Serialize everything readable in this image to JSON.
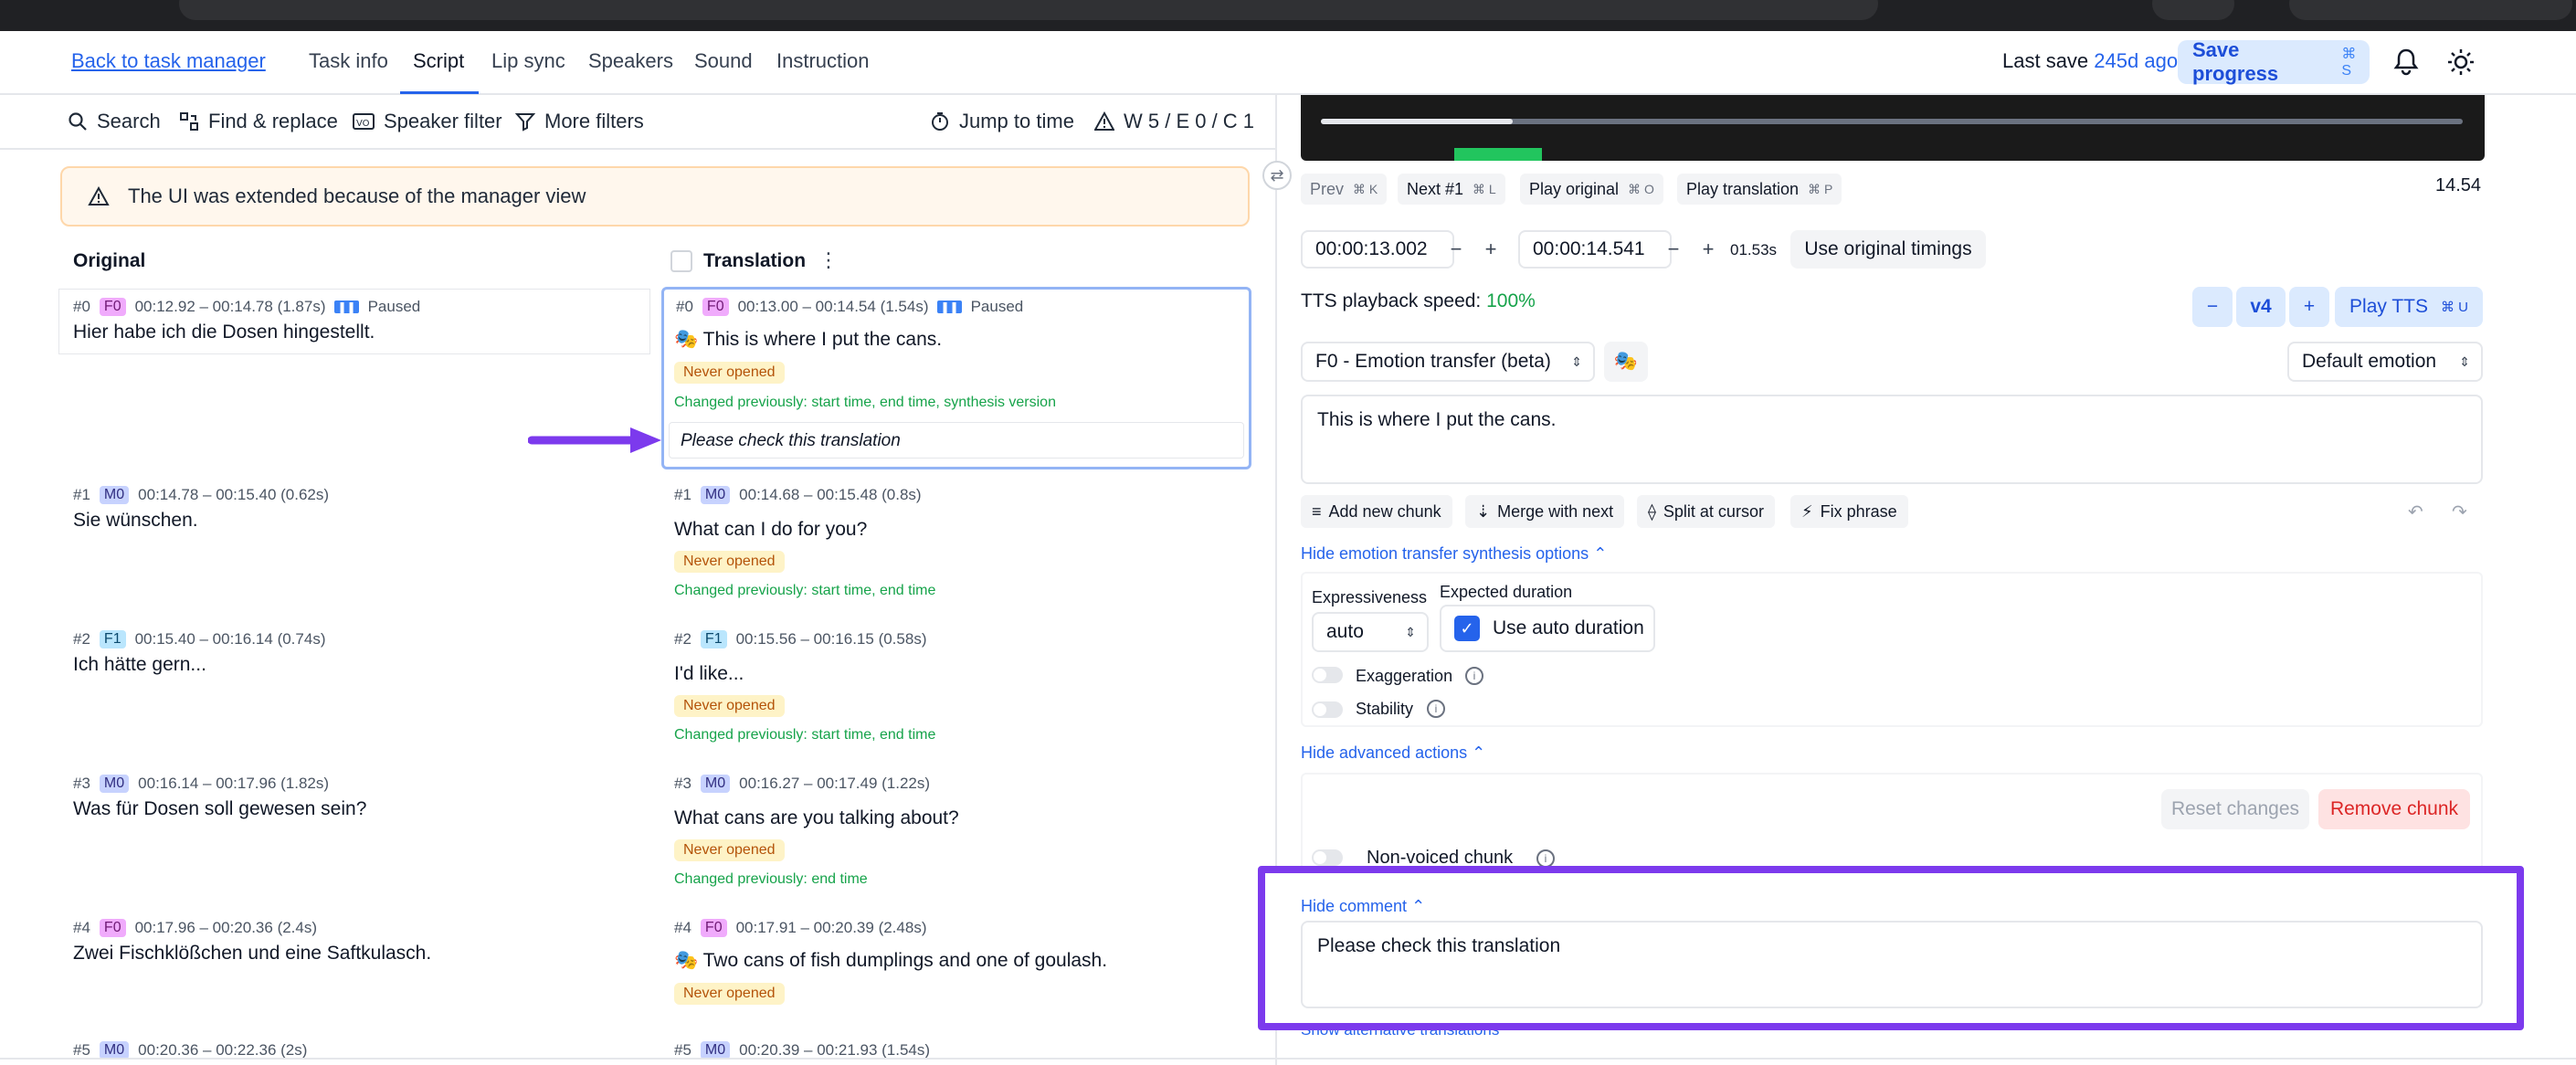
{
  "header": {
    "back_link": "Back to task manager",
    "tabs": [
      {
        "label": "Task info"
      },
      {
        "label": "Script"
      },
      {
        "label": "Lip sync"
      },
      {
        "label": "Speakers"
      },
      {
        "label": "Sound"
      },
      {
        "label": "Instruction"
      }
    ],
    "last_save_label": "Last save",
    "last_save_ago": "245d ago",
    "save_label": "Save progress",
    "save_shortcut": "⌘ S"
  },
  "toolbar": {
    "search": "Search",
    "find_replace": "Find & replace",
    "speaker_filter": "Speaker filter",
    "more_filters": "More filters",
    "jump_to_time": "Jump to time",
    "counts": "W 5 / E 0 / C 1"
  },
  "banner": {
    "text": "The UI was extended because of the manager view"
  },
  "columns": {
    "original": "Original",
    "translation": "Translation"
  },
  "chunks": [
    {
      "orig": {
        "id": "#0",
        "speaker": "F0",
        "time": "00:12.92 – 00:14.78 (1.87s)",
        "paused": "Paused",
        "text": "Hier habe ich die Dosen hingestellt."
      },
      "tr": {
        "id": "#0",
        "speaker": "F0",
        "time": "00:13.00 – 00:14.54 (1.54s)",
        "paused": "Paused",
        "text": "This is where I put the cans.",
        "status": "Never opened",
        "changed": "Changed previously: start time, end time, synthesis version",
        "comment": "Please check this translation"
      }
    },
    {
      "orig": {
        "id": "#1",
        "speaker": "M0",
        "time": "00:14.78 – 00:15.40 (0.62s)",
        "text": "Sie wünschen."
      },
      "tr": {
        "id": "#1",
        "speaker": "M0",
        "time": "00:14.68 – 00:15.48 (0.8s)",
        "text": "What can I do for you?",
        "status": "Never opened",
        "changed": "Changed previously: start time, end time"
      }
    },
    {
      "orig": {
        "id": "#2",
        "speaker": "F1",
        "time": "00:15.40 – 00:16.14 (0.74s)",
        "text": "Ich hätte gern..."
      },
      "tr": {
        "id": "#2",
        "speaker": "F1",
        "time": "00:15.56 – 00:16.15 (0.58s)",
        "text": "I'd like...",
        "status": "Never opened",
        "changed": "Changed previously: start time, end time"
      }
    },
    {
      "orig": {
        "id": "#3",
        "speaker": "M0",
        "time": "00:16.14 – 00:17.96 (1.82s)",
        "text": "Was für Dosen soll gewesen sein?"
      },
      "tr": {
        "id": "#3",
        "speaker": "M0",
        "time": "00:16.27 – 00:17.49 (1.22s)",
        "text": "What cans are you talking about?",
        "status": "Never opened",
        "changed": "Changed previously: end time"
      }
    },
    {
      "orig": {
        "id": "#4",
        "speaker": "F0",
        "time": "00:17.96 – 00:20.36 (2.4s)",
        "text": "Zwei Fischklößchen und eine Saftkulasch."
      },
      "tr": {
        "id": "#4",
        "speaker": "F0",
        "time": "00:17.91 – 00:20.39 (2.48s)",
        "text": "Two cans of fish dumplings and one of goulash.",
        "status": "Never opened"
      }
    },
    {
      "orig": {
        "id": "#5",
        "speaker": "M0",
        "time": "00:20.36 – 00:22.36 (2s)"
      },
      "tr": {
        "id": "#5",
        "speaker": "M0",
        "time": "00:20.39 – 00:21.93 (1.54s)"
      }
    }
  ],
  "player": {
    "prev": "Prev",
    "prev_key": "⌘ K",
    "next": "Next #1",
    "next_key": "⌘ L",
    "play_original": "Play original",
    "play_original_key": "⌘ O",
    "play_translation": "Play translation",
    "play_translation_key": "⌘ P",
    "time_readout": "14.54"
  },
  "timing": {
    "start": "00:00:13.002",
    "end": "00:00:14.541",
    "duration": "01.53s",
    "use_original": "Use original timings"
  },
  "tts": {
    "speed_label": "TTS playback speed:",
    "speed_value": "100%",
    "version": "v4",
    "play_tts": "Play TTS",
    "play_tts_key": "⌘ U",
    "voice_select": "F0 - Emotion transfer (beta)",
    "emotion_select": "Default emotion",
    "text": "This is where I put the cans."
  },
  "chunk_actions": {
    "add": "Add new chunk",
    "merge": "Merge with next",
    "split": "Split at cursor",
    "fix": "Fix phrase"
  },
  "synthesis": {
    "toggle_link": "Hide emotion transfer synthesis options",
    "expressiveness_label": "Expressiveness",
    "expressiveness_value": "auto",
    "expected_duration_label": "Expected duration",
    "auto_duration": "Use auto duration",
    "exaggeration": "Exaggeration",
    "stability": "Stability"
  },
  "advanced": {
    "toggle_link": "Hide advanced actions",
    "reset": "Reset changes",
    "remove": "Remove chunk",
    "non_voiced": "Non-voiced chunk"
  },
  "comment": {
    "toggle_link": "Hide comment",
    "text": "Please check this translation",
    "alt_link": "Show alternative translations"
  },
  "colors": {
    "accent": "#2563eb",
    "highlight": "#7c3aed",
    "changed": "#16a34a"
  }
}
